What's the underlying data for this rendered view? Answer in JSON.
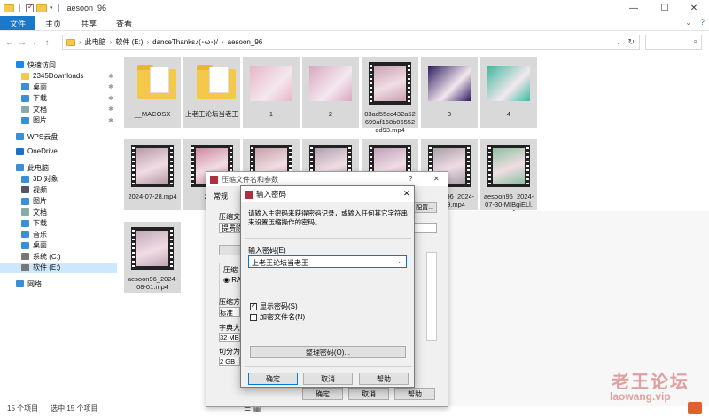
{
  "titlebar": {
    "title": "aesoon_96",
    "minimize": "—",
    "maximize": "☐",
    "close": "✕"
  },
  "ribbon": {
    "tabs": [
      "文件",
      "主页",
      "共享",
      "查看"
    ]
  },
  "address": {
    "crumbs": [
      "此电脑",
      "软件 (E:)",
      "danceThanks♪(･ω･)/",
      "aesoon_96"
    ]
  },
  "sidebar": {
    "items": [
      {
        "label": "快速访问",
        "icon": "star-icon",
        "color": "#1e88e5"
      },
      {
        "label": "2345Downloads",
        "icon": "folder-icon",
        "color": "#f2c94c"
      },
      {
        "label": "桌面",
        "icon": "desktop-icon",
        "color": "#3a8fd9"
      },
      {
        "label": "下载",
        "icon": "download-icon",
        "color": "#3a8fd9"
      },
      {
        "label": "文档",
        "icon": "document-icon",
        "color": "#8aa"
      },
      {
        "label": "图片",
        "icon": "pictures-icon",
        "color": "#3a8fd9"
      },
      {
        "label": "WPS云盘",
        "icon": "cloud-icon",
        "color": "#3a8fd9"
      },
      {
        "label": "OneDrive",
        "icon": "onedrive-icon",
        "color": "#1e6fd0"
      },
      {
        "label": "此电脑",
        "icon": "computer-icon",
        "color": "#3a8fd9"
      },
      {
        "label": "3D 对象",
        "icon": "3d-objects-icon",
        "color": "#3a8fd9"
      },
      {
        "label": "视频",
        "icon": "video-icon",
        "color": "#556"
      },
      {
        "label": "图片",
        "icon": "pictures-icon",
        "color": "#3a8fd9"
      },
      {
        "label": "文档",
        "icon": "document-icon",
        "color": "#8aa"
      },
      {
        "label": "下载",
        "icon": "download-icon",
        "color": "#3a8fd9"
      },
      {
        "label": "音乐",
        "icon": "music-icon",
        "color": "#3a8fd9"
      },
      {
        "label": "桌面",
        "icon": "desktop-icon",
        "color": "#3a8fd9"
      },
      {
        "label": "系统 (C:)",
        "icon": "drive-icon",
        "color": "#777"
      },
      {
        "label": "软件 (E:)",
        "icon": "drive-icon",
        "color": "#777"
      },
      {
        "label": "网络",
        "icon": "network-icon",
        "color": "#3a8fd9"
      }
    ]
  },
  "files": [
    {
      "name": "__MACOSX",
      "kind": "folder"
    },
    {
      "name": "上老王论坛当老王",
      "kind": "folder"
    },
    {
      "name": "1",
      "kind": "image",
      "color": "#e8b4c8"
    },
    {
      "name": "2",
      "kind": "image",
      "color": "#d8a8c0"
    },
    {
      "name": "03ad55cc432a52699af168b06552dd93.mp4",
      "kind": "video",
      "color": "#c9a0b0"
    },
    {
      "name": "3",
      "kind": "image",
      "color": "#2a1a5e"
    },
    {
      "name": "4",
      "kind": "image",
      "color": "#3fb8a0"
    },
    {
      "name": "2024-07-28.mp4",
      "kind": "video",
      "color": "#b89aa8"
    },
    {
      "name": "2024",
      "kind": "video",
      "color": "#d08aa0"
    },
    {
      "name": "",
      "kind": "video",
      "color": "#c8a0a8"
    },
    {
      "name": "",
      "kind": "video",
      "color": "#b0a0b0"
    },
    {
      "name": "",
      "kind": "video",
      "color": "#c0a0b8"
    },
    {
      "name": "aesoon96_2024-07-29.mp4",
      "kind": "video",
      "color": "#a8a0a8"
    },
    {
      "name": "aesoon96_2024-07-30-MIBgiELl.mp4",
      "kind": "video",
      "color": "#8cc0a0"
    },
    {
      "name": "aesoon96_2024-08-01.mp4",
      "kind": "video",
      "color": "#c0a8b8"
    }
  ],
  "status": {
    "count": "15 个项目",
    "selected": "选中 15 个项目"
  },
  "archive_dialog": {
    "title": "压缩文件名和参数",
    "help": "?",
    "tab_general": "常规",
    "row_name": "压缩文",
    "field_name": "提费陈",
    "profile_btn": "配置...",
    "row_format": "压缩",
    "radio_rar": "RA",
    "row_method": "压缩方",
    "method_value": "标准",
    "row_dict": "字典大",
    "dict_value": "32 MB",
    "row_split": "切分为",
    "split_value": "2 GB",
    "ok": "确定",
    "cancel": "取消",
    "help_btn": "帮助"
  },
  "password_dialog": {
    "title": "输入密码",
    "close": "✕",
    "hint": "请输入主密码来获得密码记录，或输入任何其它字符串来设置压缩操作的密码。",
    "field_label": "输入密码(E)",
    "password": "上老王论坛当老王",
    "show_password": "显示密码(S)",
    "encrypt_names": "加密文件名(N)",
    "organize": "整理密码(O)...",
    "ok": "确定",
    "cancel": "取消",
    "help": "帮助"
  },
  "watermark": {
    "cn": "老王论坛",
    "en": "laowang.vip"
  }
}
